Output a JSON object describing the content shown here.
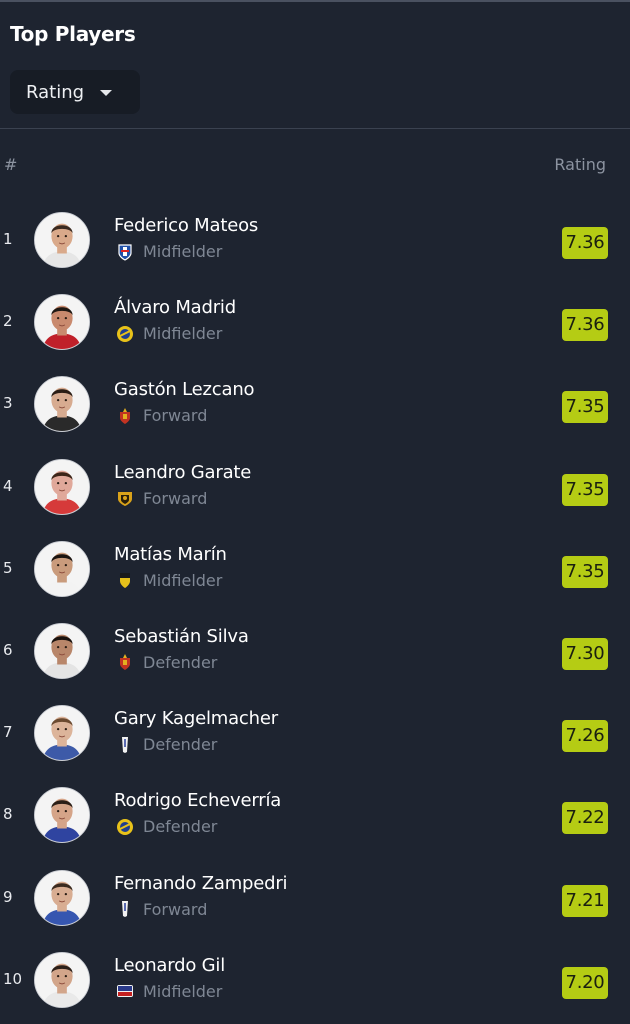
{
  "header": {
    "title": "Top Players",
    "sort_dropdown": {
      "selected": "Rating",
      "icon": "caret-down-icon"
    }
  },
  "columns": {
    "rank": "#",
    "rating": "Rating"
  },
  "colors": {
    "background": "#1e2430",
    "rating_badge": "#b5cc14",
    "muted_text": "#7f8794"
  },
  "players": [
    {
      "rank": "1",
      "name": "Federico Mateos",
      "position": "Midfielder",
      "rating": "7.36",
      "crest": "crest-blue-white",
      "skin": "#d9a98a",
      "hair": "#3a2a20",
      "shirt": "#e6e6e6"
    },
    {
      "rank": "2",
      "name": "Álvaro Madrid",
      "position": "Midfielder",
      "rating": "7.36",
      "crest": "crest-yellow-blue-round",
      "skin": "#c98a6e",
      "hair": "#1e1712",
      "shirt": "#c0202a"
    },
    {
      "rank": "3",
      "name": "Gastón Lezcano",
      "position": "Forward",
      "rating": "7.35",
      "crest": "crest-red-gold",
      "skin": "#d7ab90",
      "hair": "#2a1d15",
      "shirt": "#2a2a2a"
    },
    {
      "rank": "4",
      "name": "Leandro Garate",
      "position": "Forward",
      "rating": "7.35",
      "crest": "crest-gold-black",
      "skin": "#e0a89a",
      "hair": "#3b2418",
      "shirt": "#d63a3a"
    },
    {
      "rank": "5",
      "name": "Matías Marín",
      "position": "Midfielder",
      "rating": "7.35",
      "crest": "crest-yellow-black",
      "skin": "#c99b7c",
      "hair": "#1b1410",
      "shirt": "#f3f3f3"
    },
    {
      "rank": "6",
      "name": "Sebastián Silva",
      "position": "Defender",
      "rating": "7.30",
      "crest": "crest-red-gold",
      "skin": "#b8866a",
      "hair": "#1a120e",
      "shirt": "#e4e4e4"
    },
    {
      "rank": "7",
      "name": "Gary Kagelmacher",
      "position": "Defender",
      "rating": "7.26",
      "crest": "crest-white-banner",
      "skin": "#dcb49a",
      "hair": "#6b4a30",
      "shirt": "#3d5aa8"
    },
    {
      "rank": "8",
      "name": "Rodrigo Echeverría",
      "position": "Defender",
      "rating": "7.22",
      "crest": "crest-yellow-blue-round",
      "skin": "#d5a488",
      "hair": "#2b1f17",
      "shirt": "#2f44a0"
    },
    {
      "rank": "9",
      "name": "Fernando Zampedri",
      "position": "Forward",
      "rating": "7.21",
      "crest": "crest-white-banner",
      "skin": "#d8ad92",
      "hair": "#3a2a1f",
      "shirt": "#3656b0"
    },
    {
      "rank": "10",
      "name": "Leonardo Gil",
      "position": "Midfielder",
      "rating": "7.20",
      "crest": "crest-colo-colo",
      "skin": "#d2a58a",
      "hair": "#2c2019",
      "shirt": "#e9e9e9"
    }
  ]
}
